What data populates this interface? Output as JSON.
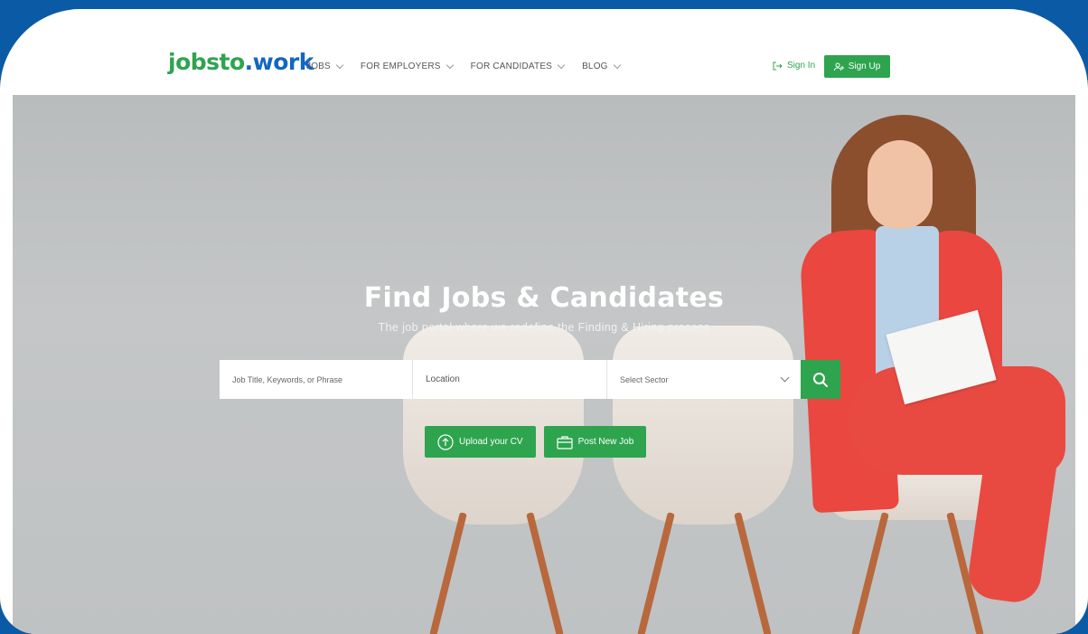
{
  "header": {
    "logo_part1": "jobsto",
    "logo_part2": "work",
    "logo_dot": ".",
    "nav": [
      {
        "label": "JOBS"
      },
      {
        "label": "FOR EMPLOYERS"
      },
      {
        "label": "FOR CANDIDATES"
      },
      {
        "label": "BLOG"
      }
    ],
    "sign_in": "Sign In",
    "sign_up": "Sign Up"
  },
  "hero": {
    "title": "Find Jobs & Candidates",
    "subtitle": "The job portal where we redefine the Finding & Hiring process"
  },
  "search": {
    "keywords_placeholder": "Job Title, Keywords, or Phrase",
    "location_placeholder": "Location",
    "sector_selected": "Select Sector"
  },
  "actions": {
    "upload_cv": "Upload your CV",
    "post_job": "Post New Job"
  },
  "colors": {
    "brand_green": "#2ea44f",
    "brand_blue": "#1466c0",
    "frame_blue": "#0b5aa6"
  }
}
